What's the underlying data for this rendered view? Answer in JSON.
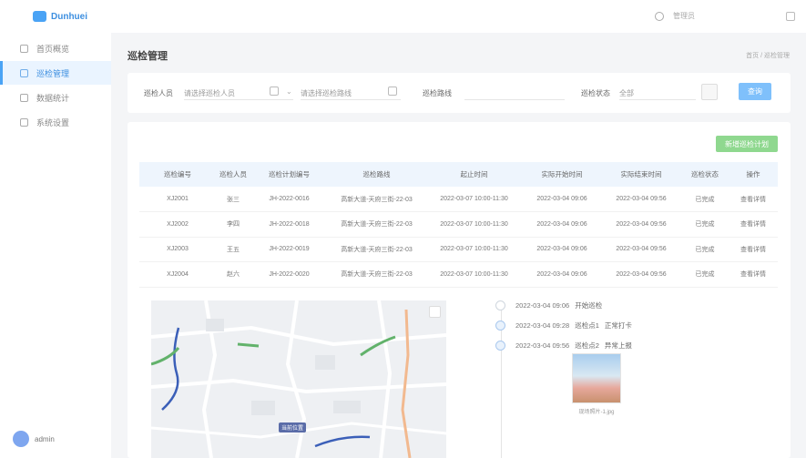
{
  "app": {
    "logo_text": "Dunhuei",
    "top_user": "管理员"
  },
  "sidebar": {
    "items": [
      {
        "label": "首页概览"
      },
      {
        "label": "巡检管理"
      },
      {
        "label": "数据统计"
      },
      {
        "label": "系统设置"
      }
    ],
    "user_name": "admin"
  },
  "page": {
    "title": "巡检管理",
    "breadcrumb": "首页 / 巡检管理"
  },
  "filter": {
    "label_1": "巡检人员",
    "placeholder_1": "请选择巡检人员",
    "label_2": "巡检路线",
    "placeholder_2": "请选择巡检路线",
    "label_3": "巡检状态",
    "value_3": "全部",
    "query_label": "查询"
  },
  "table": {
    "new_label": "新增巡检计划",
    "headers": [
      "巡检编号",
      "巡检人员",
      "巡检计划编号",
      "巡检路线",
      "起止时间",
      "实际开始时间",
      "实际结束时间",
      "巡检状态",
      "操作"
    ],
    "rows": [
      [
        "XJ2001",
        "张三",
        "JH-2022-0016",
        "高新大道-天府三街-22-03",
        "2022-03-07 10:00-11:30",
        "2022-03-04 09:06",
        "2022-03-04 09:56",
        "已完成",
        "查看详情"
      ],
      [
        "XJ2002",
        "李四",
        "JH-2022-0018",
        "高新大道-天府三街-22-03",
        "2022-03-07 10:00-11:30",
        "2022-03-04 09:06",
        "2022-03-04 09:56",
        "已完成",
        "查看详情"
      ],
      [
        "XJ2003",
        "王五",
        "JH-2022-0019",
        "高新大道-天府三街-22-03",
        "2022-03-07 10:00-11:30",
        "2022-03-04 09:06",
        "2022-03-04 09:56",
        "已完成",
        "查看详情"
      ],
      [
        "XJ2004",
        "赵六",
        "JH-2022-0020",
        "高新大道-天府三街-22-03",
        "2022-03-07 10:00-11:30",
        "2022-03-04 09:06",
        "2022-03-04 09:56",
        "已完成",
        "查看详情"
      ]
    ]
  },
  "map": {
    "marker_label": "当前位置"
  },
  "timeline": {
    "events": [
      {
        "time": "2022-03-04 09:06",
        "status": "开始巡检",
        "detail": ""
      },
      {
        "time": "2022-03-04 09:28",
        "status": "巡检点1",
        "detail": "正常打卡"
      },
      {
        "time": "2022-03-04 09:56",
        "status": "巡检点2",
        "detail": "异常上报"
      }
    ],
    "photo_caption": "现场照片-1.jpg"
  },
  "colors": {
    "accent": "#4aa3f5",
    "query_button": "#7fc0fb",
    "new_button": "#8fd88f",
    "table_header": "#eef5fd"
  }
}
